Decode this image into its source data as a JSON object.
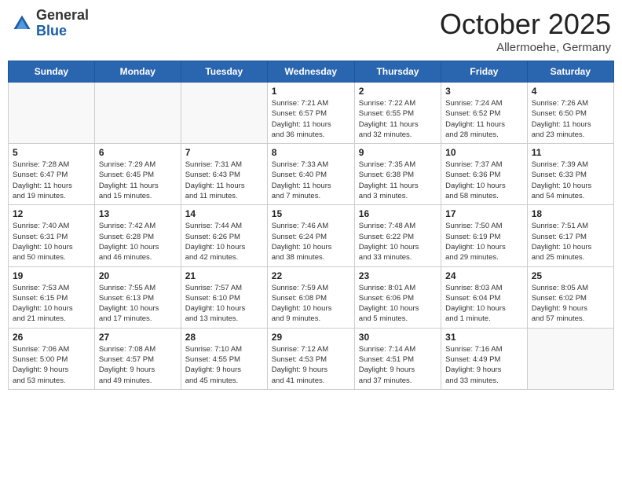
{
  "logo": {
    "general": "General",
    "blue": "Blue"
  },
  "header": {
    "month": "October 2025",
    "location": "Allermoehe, Germany"
  },
  "weekdays": [
    "Sunday",
    "Monday",
    "Tuesday",
    "Wednesday",
    "Thursday",
    "Friday",
    "Saturday"
  ],
  "weeks": [
    [
      {
        "day": "",
        "info": ""
      },
      {
        "day": "",
        "info": ""
      },
      {
        "day": "",
        "info": ""
      },
      {
        "day": "1",
        "info": "Sunrise: 7:21 AM\nSunset: 6:57 PM\nDaylight: 11 hours\nand 36 minutes."
      },
      {
        "day": "2",
        "info": "Sunrise: 7:22 AM\nSunset: 6:55 PM\nDaylight: 11 hours\nand 32 minutes."
      },
      {
        "day": "3",
        "info": "Sunrise: 7:24 AM\nSunset: 6:52 PM\nDaylight: 11 hours\nand 28 minutes."
      },
      {
        "day": "4",
        "info": "Sunrise: 7:26 AM\nSunset: 6:50 PM\nDaylight: 11 hours\nand 23 minutes."
      }
    ],
    [
      {
        "day": "5",
        "info": "Sunrise: 7:28 AM\nSunset: 6:47 PM\nDaylight: 11 hours\nand 19 minutes."
      },
      {
        "day": "6",
        "info": "Sunrise: 7:29 AM\nSunset: 6:45 PM\nDaylight: 11 hours\nand 15 minutes."
      },
      {
        "day": "7",
        "info": "Sunrise: 7:31 AM\nSunset: 6:43 PM\nDaylight: 11 hours\nand 11 minutes."
      },
      {
        "day": "8",
        "info": "Sunrise: 7:33 AM\nSunset: 6:40 PM\nDaylight: 11 hours\nand 7 minutes."
      },
      {
        "day": "9",
        "info": "Sunrise: 7:35 AM\nSunset: 6:38 PM\nDaylight: 11 hours\nand 3 minutes."
      },
      {
        "day": "10",
        "info": "Sunrise: 7:37 AM\nSunset: 6:36 PM\nDaylight: 10 hours\nand 58 minutes."
      },
      {
        "day": "11",
        "info": "Sunrise: 7:39 AM\nSunset: 6:33 PM\nDaylight: 10 hours\nand 54 minutes."
      }
    ],
    [
      {
        "day": "12",
        "info": "Sunrise: 7:40 AM\nSunset: 6:31 PM\nDaylight: 10 hours\nand 50 minutes."
      },
      {
        "day": "13",
        "info": "Sunrise: 7:42 AM\nSunset: 6:28 PM\nDaylight: 10 hours\nand 46 minutes."
      },
      {
        "day": "14",
        "info": "Sunrise: 7:44 AM\nSunset: 6:26 PM\nDaylight: 10 hours\nand 42 minutes."
      },
      {
        "day": "15",
        "info": "Sunrise: 7:46 AM\nSunset: 6:24 PM\nDaylight: 10 hours\nand 38 minutes."
      },
      {
        "day": "16",
        "info": "Sunrise: 7:48 AM\nSunset: 6:22 PM\nDaylight: 10 hours\nand 33 minutes."
      },
      {
        "day": "17",
        "info": "Sunrise: 7:50 AM\nSunset: 6:19 PM\nDaylight: 10 hours\nand 29 minutes."
      },
      {
        "day": "18",
        "info": "Sunrise: 7:51 AM\nSunset: 6:17 PM\nDaylight: 10 hours\nand 25 minutes."
      }
    ],
    [
      {
        "day": "19",
        "info": "Sunrise: 7:53 AM\nSunset: 6:15 PM\nDaylight: 10 hours\nand 21 minutes."
      },
      {
        "day": "20",
        "info": "Sunrise: 7:55 AM\nSunset: 6:13 PM\nDaylight: 10 hours\nand 17 minutes."
      },
      {
        "day": "21",
        "info": "Sunrise: 7:57 AM\nSunset: 6:10 PM\nDaylight: 10 hours\nand 13 minutes."
      },
      {
        "day": "22",
        "info": "Sunrise: 7:59 AM\nSunset: 6:08 PM\nDaylight: 10 hours\nand 9 minutes."
      },
      {
        "day": "23",
        "info": "Sunrise: 8:01 AM\nSunset: 6:06 PM\nDaylight: 10 hours\nand 5 minutes."
      },
      {
        "day": "24",
        "info": "Sunrise: 8:03 AM\nSunset: 6:04 PM\nDaylight: 10 hours\nand 1 minute."
      },
      {
        "day": "25",
        "info": "Sunrise: 8:05 AM\nSunset: 6:02 PM\nDaylight: 9 hours\nand 57 minutes."
      }
    ],
    [
      {
        "day": "26",
        "info": "Sunrise: 7:06 AM\nSunset: 5:00 PM\nDaylight: 9 hours\nand 53 minutes."
      },
      {
        "day": "27",
        "info": "Sunrise: 7:08 AM\nSunset: 4:57 PM\nDaylight: 9 hours\nand 49 minutes."
      },
      {
        "day": "28",
        "info": "Sunrise: 7:10 AM\nSunset: 4:55 PM\nDaylight: 9 hours\nand 45 minutes."
      },
      {
        "day": "29",
        "info": "Sunrise: 7:12 AM\nSunset: 4:53 PM\nDaylight: 9 hours\nand 41 minutes."
      },
      {
        "day": "30",
        "info": "Sunrise: 7:14 AM\nSunset: 4:51 PM\nDaylight: 9 hours\nand 37 minutes."
      },
      {
        "day": "31",
        "info": "Sunrise: 7:16 AM\nSunset: 4:49 PM\nDaylight: 9 hours\nand 33 minutes."
      },
      {
        "day": "",
        "info": ""
      }
    ]
  ]
}
